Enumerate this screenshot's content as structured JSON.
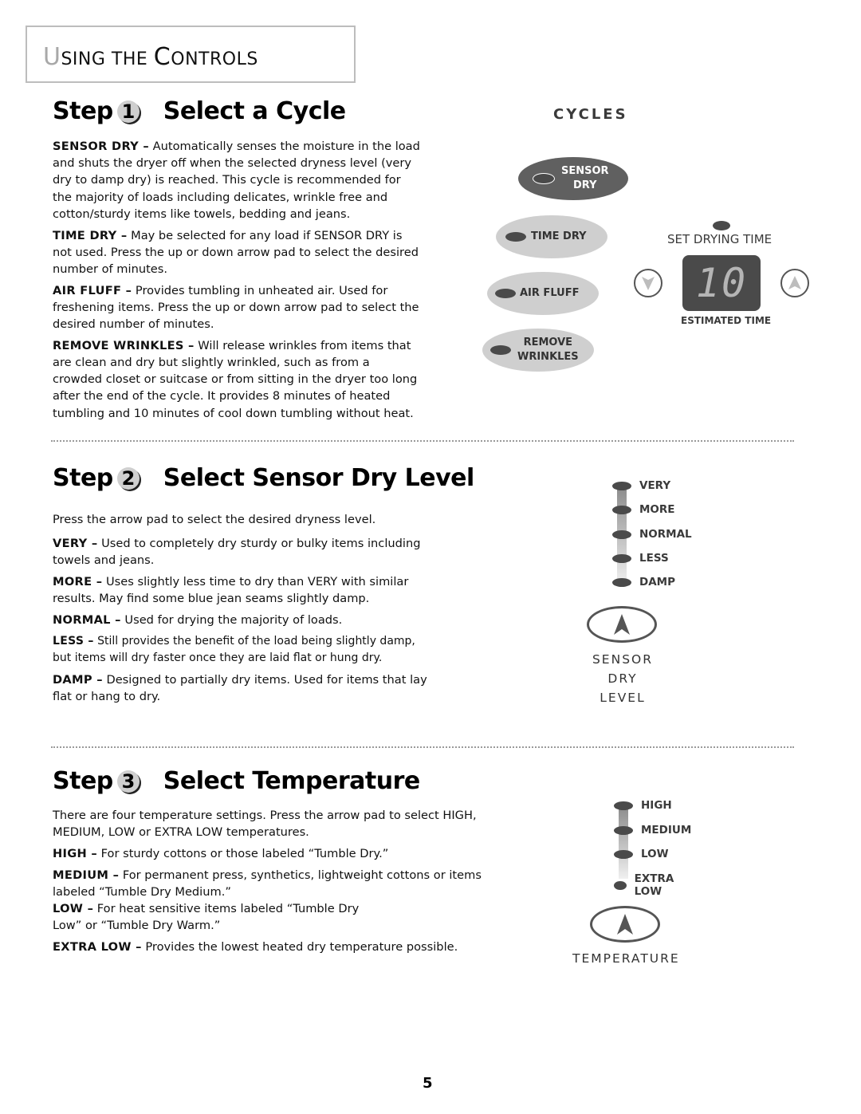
{
  "header": {
    "title_first_letter": "U",
    "title_rest_1": "SING THE ",
    "title_cap_2": "C",
    "title_rest_2": "ONTROLS"
  },
  "step1": {
    "step_word": "Step",
    "number": "1",
    "title": "Select a Cycle",
    "paragraphs": [
      {
        "term": "SENSOR DRY –",
        "text": " Automatically senses the moisture in the load and shuts the dryer off when the selected dryness level (very dry to damp dry) is reached. This cycle is recommended for the majority of loads including delicates, wrinkle free and cotton/sturdy items like towels, bedding and jeans."
      },
      {
        "term": "TIME DRY –",
        "text": " May be selected for any load if SENSOR DRY is not used. Press the up or down arrow pad to select the desired number of minutes."
      },
      {
        "term": "AIR FLUFF –",
        "text": " Provides tumbling in unheated air. Used for freshening items. Press the up or down arrow pad to select the desired number of minutes."
      },
      {
        "term": "REMOVE WRINKLES –",
        "text": " Will release wrinkles from items that are clean and dry but slightly wrinkled, such as from a crowded closet or suitcase or from sitting in the dryer too long after the end of the cycle. It provides 8 minutes of heated tumbling and 10 minutes of cool down tumbling without heat."
      }
    ],
    "panel": {
      "cycles_label": "CYCLES",
      "buttons": [
        {
          "line1": "SENSOR",
          "line2": "DRY",
          "active": true
        },
        {
          "line1": "TIME DRY",
          "line2": "",
          "active": false
        },
        {
          "line1": "AIR FLUFF",
          "line2": "",
          "active": false
        },
        {
          "line1": "REMOVE",
          "line2": "WRINKLES",
          "active": false
        }
      ],
      "set_drying_time_label": "SET DRYING TIME",
      "display_value": "10",
      "estimated_time_label": "ESTIMATED TIME",
      "down_arrow_icon": "chevron-down-icon",
      "up_arrow_icon": "chevron-up-icon"
    }
  },
  "step2": {
    "step_word": "Step",
    "number": "2",
    "title": "Select Sensor Dry Level",
    "intro": "Press the arrow pad to select the desired dryness level.",
    "paragraphs": [
      {
        "term": "VERY  –",
        "text": " Used to completely dry sturdy or bulky items including towels and jeans."
      },
      {
        "term": "MORE –",
        "text": " Uses slightly less time to dry than VERY with similar results. May find some blue jean seams slightly damp."
      },
      {
        "term": "NORMAL –",
        "text": " Used for drying the majority of loads."
      },
      {
        "term": "LESS –",
        "text": " Still provides the benefit of the load being slightly damp, but items will dry faster once they are laid flat or hung dry."
      },
      {
        "term": "DAMP –",
        "text": " Designed to partially dry items. Used for items that lay flat or hang to dry."
      }
    ],
    "panel": {
      "levels": [
        "VERY",
        "MORE",
        "NORMAL",
        "LESS",
        "DAMP"
      ],
      "caption_lines": [
        "SENSOR",
        "DRY",
        "LEVEL"
      ]
    }
  },
  "step3": {
    "step_word": "Step",
    "number": "3",
    "title": "Select Temperature",
    "intro": "There are four temperature settings. Press the arrow pad to select HIGH, MEDIUM, LOW or EXTRA LOW temperatures.",
    "paragraphs": [
      {
        "term": "HIGH –",
        "text": " For sturdy cottons or those labeled “Tumble Dry.”"
      },
      {
        "term": "MEDIUM –",
        "text": " For permanent press, synthetics, lightweight cottons or items labeled “Tumble Dry Medium.”"
      },
      {
        "term": "LOW –",
        "text": " For heat sensitive items labeled “Tumble Dry Low” or “Tumble Dry Warm.”"
      },
      {
        "term": "EXTRA LOW –",
        "text": " Provides the lowest heated dry temperature possible."
      }
    ],
    "panel": {
      "levels": [
        "HIGH",
        "MEDIUM",
        "LOW",
        "EXTRA LOW"
      ],
      "caption": "TEMPERATURE"
    }
  },
  "footer": {
    "page_number": "5"
  }
}
